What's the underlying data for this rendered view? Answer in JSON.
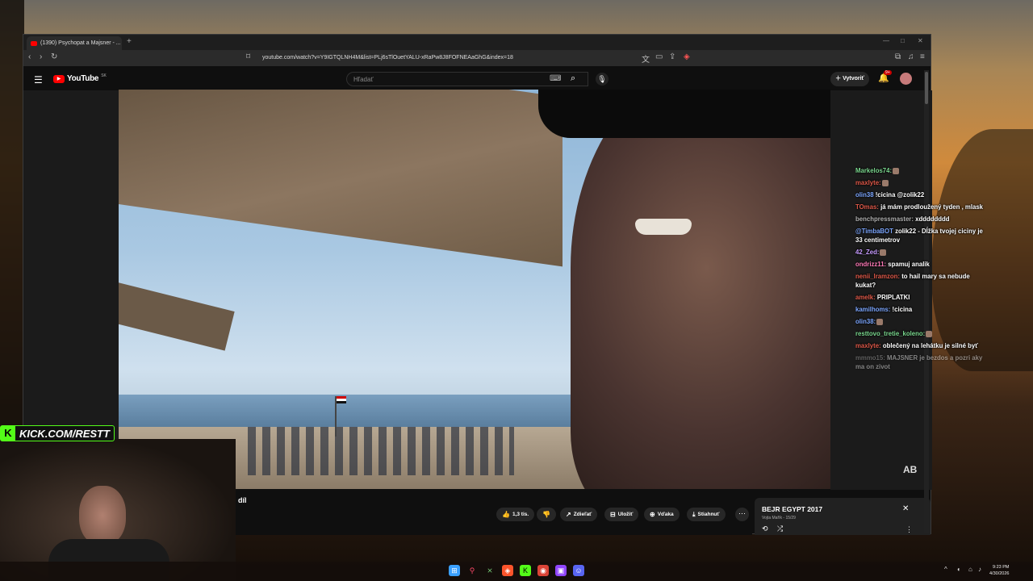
{
  "browser": {
    "tab_title": "(1390) Psychopat a Majsner - ...",
    "new_tab": "+",
    "url": "youtube.com/watch?v=Y9IGTQLNH4M&list=PLj6sTlOuetYALU-xRaPw8J8FOFNEAaGhG&index=18"
  },
  "youtube": {
    "logo_text": "YouTube",
    "country_code": "SK",
    "search_placeholder": "Hľadať",
    "create_label": "Vytvoriť",
    "notifications_badge": "9+"
  },
  "video": {
    "title_fragment": "díl",
    "watermark": "AB"
  },
  "actions": {
    "like_count": "1,3 tis.",
    "share": "Zdieľať",
    "save": "Uložiť",
    "thanks": "Vďaka",
    "download": "Stiahnuť"
  },
  "playlist": {
    "title": "BEJR EGYPT 2017",
    "subtitle": "Vojta Mařík - 15/29"
  },
  "chat": [
    {
      "user": "Markelos74:",
      "msg": "",
      "color": "green"
    },
    {
      "user": "maxlyte:",
      "msg": "",
      "color": "red"
    },
    {
      "user": "olin38",
      "msg": "!cicina @zolik22",
      "color": "blue"
    },
    {
      "user": "TOmas:",
      "msg": "já mám prodloužený tyden , mlask",
      "color": "red"
    },
    {
      "user": "benchpressmaster:",
      "msg": "xdddddddd",
      "color": "gray"
    },
    {
      "user": "@TimbaBOT",
      "msg": "zolik22 - Dĺžka tvojej ciciny je 33 centimetrov",
      "color": "blue",
      "wrap": true
    },
    {
      "user": "42_Zed:",
      "msg": "",
      "color": "purple"
    },
    {
      "user": "ondrizz11:",
      "msg": "spamuj analik",
      "color": "pink"
    },
    {
      "user": "nenii_lramzon:",
      "msg": "to hail mary sa nebude kukat?",
      "color": "red",
      "wrap": true
    },
    {
      "user": "amelk:",
      "msg": "PRIPLATKI",
      "color": "red"
    },
    {
      "user": "kamilhoms:",
      "msg": "!cicina",
      "color": "blue"
    },
    {
      "user": "olin38:",
      "msg": "",
      "color": "blue"
    },
    {
      "user": "resttovo_tretie_koleno:",
      "msg": "",
      "color": "green"
    },
    {
      "user": "maxlyte:",
      "msg": "oblečený na lehátku je silné byť",
      "color": "red"
    },
    {
      "user": "mmmo15:",
      "msg": "MAJSNER je bezdos a pozri aky ma on zivot",
      "color": "gray",
      "wrap": true,
      "faded": true
    }
  ],
  "overlay": {
    "kick_handle": "KICK.COM/RESTT"
  },
  "taskbar": {
    "time": "9:23 PM",
    "date": "4/30/2026"
  }
}
